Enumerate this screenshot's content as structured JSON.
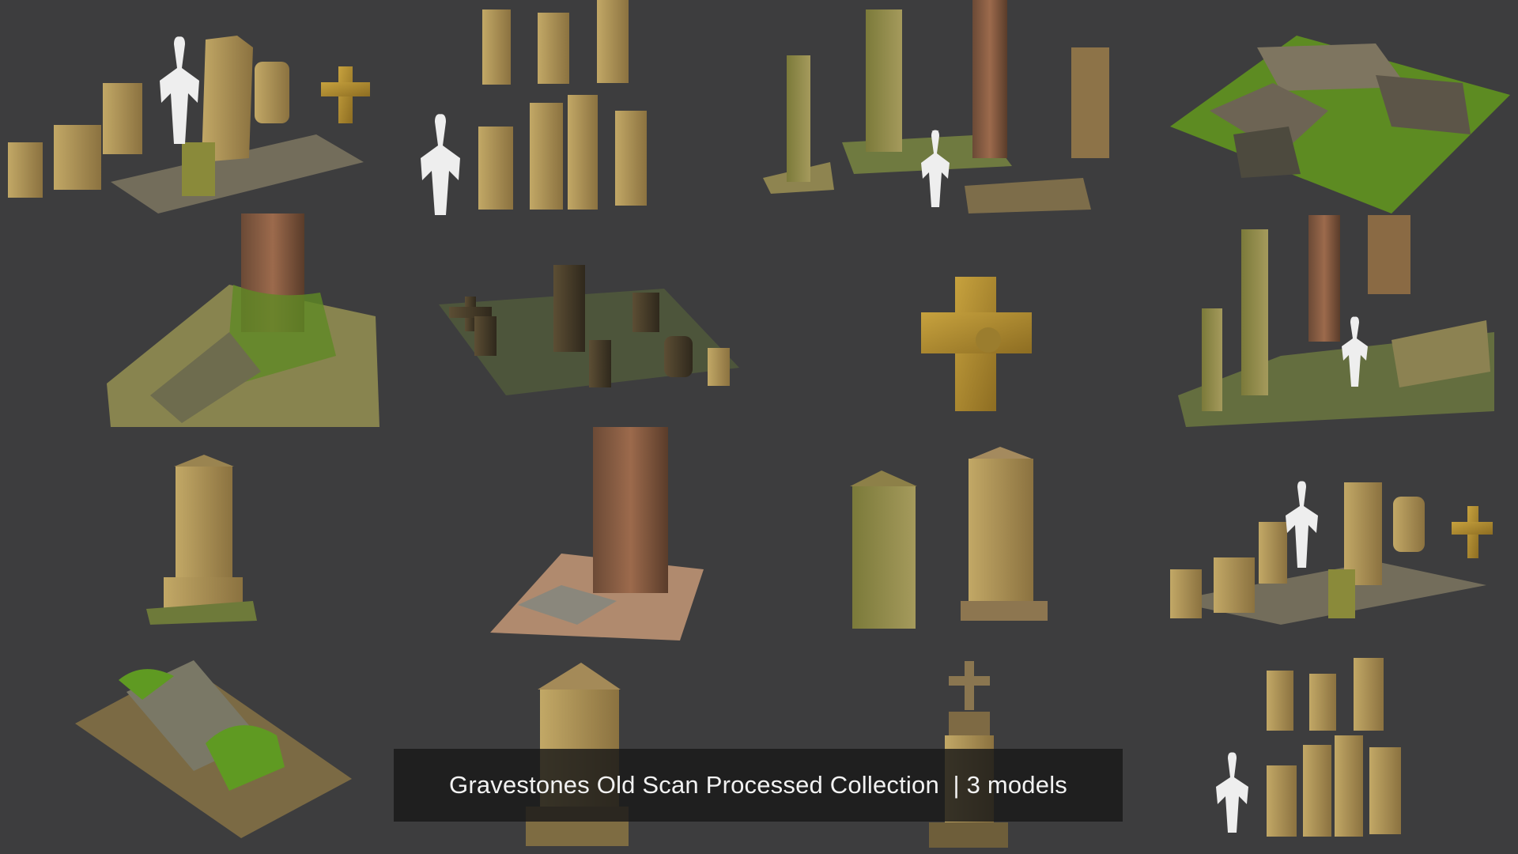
{
  "caption": {
    "title": "Gravestones Old Scan Processed Collection",
    "separator": "  | ",
    "count": "3 models"
  },
  "colors": {
    "background": "#3d3d3e",
    "caption_bg": "#181818",
    "caption_text": "#f2f2f2",
    "stone": "#a48a4e",
    "moss": "#6e8a2a",
    "bark": "#8a5a40"
  },
  "tiles": [
    "gravestone-lineup-with-human-scale",
    "gravestone-pairs-with-human-scale",
    "tree-stumps-and-tomb",
    "mossy-slab-grave",
    "tree-base-with-slab",
    "cemetery-group-dark",
    "stone-cross",
    "trees-with-human-scale",
    "obelisk-gravestone",
    "tree-trunk-with-slab",
    "two-obelisks",
    "gravestone-lineup-small",
    "mossy-tomb-slab",
    "pedestal-gravestone",
    "cross-monument",
    "gravestone-pairs-small"
  ]
}
